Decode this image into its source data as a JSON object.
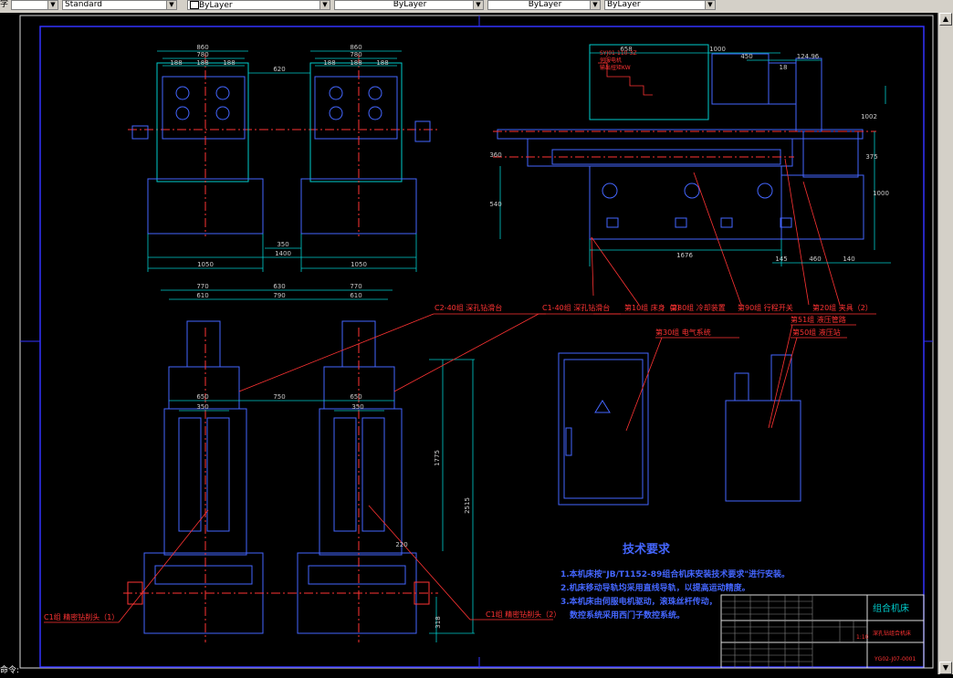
{
  "toolbar": {
    "left_label": "字",
    "text_style": "Standard",
    "layer_color": "ByLayer",
    "linetype": "ByLayer",
    "lineweight": "ByLayer",
    "plot_style": "ByLayer"
  },
  "status": {
    "prompt": "命令:"
  },
  "drawing": {
    "tech_title": "技术要求",
    "tech_items": [
      "1.本机床按\"JB/T1152-89组合机床安装技术要求\"进行安装。",
      "2.机床移动导轨均采用直线导轨，以提高运动精度。",
      "3.本机床由伺服电机驱动，滚珠丝杆传动，",
      "数控系统采用西门子数控系统。"
    ],
    "callouts": [
      "C2-40组 深孔钻滑台",
      "C1-40组 深孔钻滑台",
      "第10组 床身（2）",
      "第80组 冷却装置",
      "第90组 行程开关",
      "第20组 夹具（2）",
      "第30组 电气系统",
      "第51组 液压管路",
      "第50组 液压站",
      "C1组 精密钻削头（1）",
      "C1组 精密钻削头（2）"
    ],
    "motor_note": [
      "SYJ01-110-3Z",
      "伺服电机",
      "输出扭矩KW"
    ],
    "title_block": {
      "name": "组合机床",
      "sub": "深孔钻组合机床",
      "code": "YG02-J07-0001",
      "scale": "1:10"
    },
    "dims": {
      "top_left": [
        "860",
        "780",
        "188",
        "188",
        "188",
        "620",
        "860",
        "780",
        "188",
        "188",
        "188",
        "350",
        "1400",
        "1050",
        "1050"
      ],
      "top_right": [
        "658",
        "1000",
        "450",
        "18",
        "124.96",
        "1676",
        "145",
        "460",
        "140",
        "540",
        "360",
        "1000",
        "375",
        "1002"
      ],
      "bottom_left": [
        "770",
        "630",
        "770",
        "610",
        "790",
        "610",
        "650",
        "750",
        "650",
        "350",
        "350",
        "1775",
        "2515",
        "220",
        "318"
      ]
    }
  }
}
